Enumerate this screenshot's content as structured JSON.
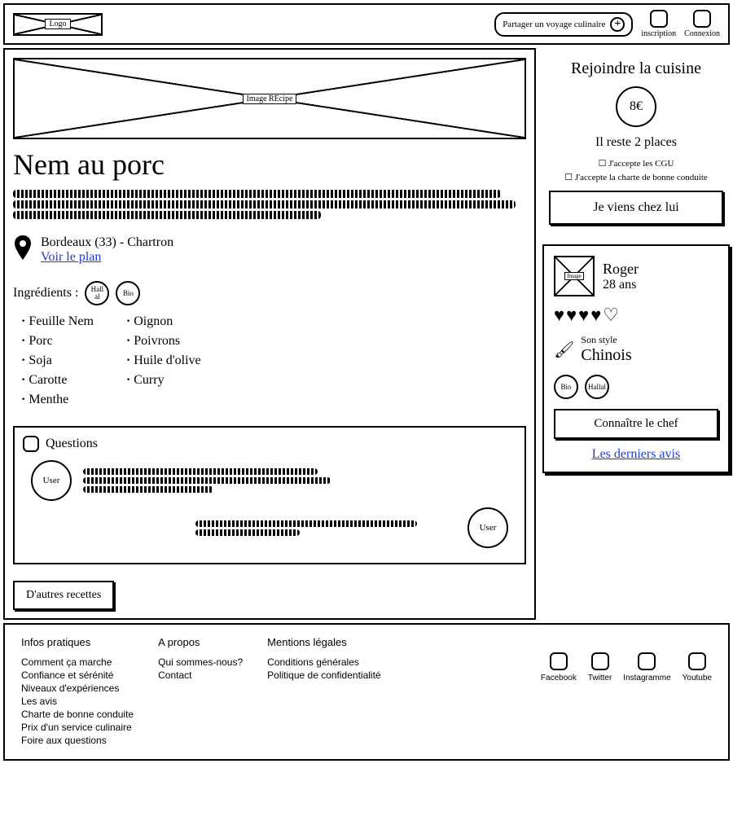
{
  "header": {
    "logo_label": "Logo",
    "share_label": "Partager un voyage culinaire",
    "signup_label": "inscription",
    "login_label": "Connexion"
  },
  "recipe": {
    "image_label": "Image REcipe",
    "title": "Nem au porc",
    "location_text": "Bordeaux (33) - Chartron",
    "map_link": "Voir le plan",
    "ingredients_label": "Ingrédients :",
    "badge_hallal": "Hall al",
    "badge_bio": "Bio",
    "ingredients_col1": [
      "Feuille Nem",
      "Porc",
      "Soja",
      "Carotte",
      "Menthe"
    ],
    "ingredients_col2": [
      "Oignon",
      "Poivrons",
      "Huile d'olive",
      "Curry"
    ],
    "questions_label": "Questions",
    "user_label": "User",
    "other_recipes_btn": "D'autres recettes"
  },
  "join": {
    "title": "Rejoindre la cuisine",
    "price": "8€",
    "places": "Il reste 2 places",
    "cgu": "J'accepte les CGU",
    "charte": "J'accepte la charte de bonne conduite",
    "button": "Je viens chez lui"
  },
  "chef": {
    "img_label": "Image",
    "name": "Roger",
    "age": "28 ans",
    "style_label": "Son style",
    "style_value": "Chinois",
    "badge_bio": "Bio",
    "badge_hallal": "Hallal",
    "know_btn": "Connaître le chef",
    "reviews_link": "Les derniers avis"
  },
  "footer": {
    "col1_title": "Infos pratiques",
    "col1": [
      "Comment ça marche",
      "Confiance et sérénité",
      "Niveaux d'expériences",
      "Les avis",
      "Charte de bonne conduite",
      "Prix d'un service culinaire",
      "Foire aux questions"
    ],
    "col2_title": "A propos",
    "col2": [
      "Qui sommes-nous?",
      "Contact"
    ],
    "col3_title": "Mentions légales",
    "col3": [
      "Conditions générales",
      "Politique de confidentialité"
    ],
    "social": [
      "Facebook",
      "Twitter",
      "Instagramme",
      "Youtube"
    ]
  }
}
